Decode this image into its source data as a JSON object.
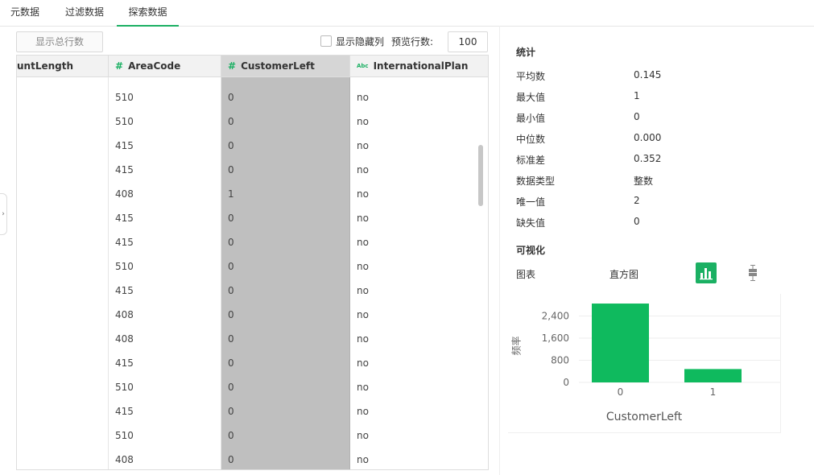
{
  "tabs": [
    {
      "label": "元数据",
      "active": false
    },
    {
      "label": "过滤数据",
      "active": false
    },
    {
      "label": "探索数据",
      "active": true
    }
  ],
  "toolbar": {
    "show_total_rows": "显示总行数",
    "show_hidden_cols": "显示隐藏列",
    "preview_rows_label": "预览行数:",
    "preview_rows_value": "100"
  },
  "grid": {
    "columns": [
      {
        "label": "untLength",
        "type": "none",
        "selected": false
      },
      {
        "label": "AreaCode",
        "type": "#",
        "selected": false
      },
      {
        "label": "CustomerLeft",
        "type": "#",
        "selected": true
      },
      {
        "label": "InternationalPlan",
        "type": "Abc",
        "selected": false
      }
    ],
    "rows": [
      [
        "",
        "510",
        "0",
        "no"
      ],
      [
        "",
        "510",
        "0",
        "no"
      ],
      [
        "",
        "415",
        "0",
        "no"
      ],
      [
        "",
        "415",
        "0",
        "no"
      ],
      [
        "",
        "408",
        "1",
        "no"
      ],
      [
        "",
        "415",
        "0",
        "no"
      ],
      [
        "",
        "415",
        "0",
        "no"
      ],
      [
        "",
        "510",
        "0",
        "no"
      ],
      [
        "",
        "415",
        "0",
        "no"
      ],
      [
        "",
        "408",
        "0",
        "no"
      ],
      [
        "",
        "408",
        "0",
        "no"
      ],
      [
        "",
        "415",
        "0",
        "no"
      ],
      [
        "",
        "510",
        "0",
        "no"
      ],
      [
        "",
        "415",
        "0",
        "no"
      ],
      [
        "",
        "510",
        "0",
        "no"
      ],
      [
        "",
        "408",
        "0",
        "no"
      ]
    ]
  },
  "stats": {
    "title": "统计",
    "items": [
      {
        "label": "平均数",
        "value": "0.145"
      },
      {
        "label": "最大值",
        "value": "1"
      },
      {
        "label": "最小值",
        "value": "0"
      },
      {
        "label": "中位数",
        "value": "0.000"
      },
      {
        "label": "标准差",
        "value": "0.352"
      },
      {
        "label": "数据类型",
        "value": "整数"
      },
      {
        "label": "唯一值",
        "value": "2"
      },
      {
        "label": "缺失值",
        "value": "0"
      }
    ]
  },
  "viz": {
    "title": "可视化",
    "chart_label": "图表",
    "chart_type": "直方图",
    "icons": {
      "histogram": "bar-chart-icon",
      "boxplot": "boxplot-icon"
    }
  },
  "colors": {
    "accent": "#1bb063",
    "bar": "#0fba5e",
    "selected_col": "#bfbfbf"
  },
  "chart_data": {
    "type": "bar",
    "categories": [
      "0",
      "1"
    ],
    "values": [
      2850,
      483
    ],
    "xlabel": "CustomerLeft",
    "ylabel": "频率",
    "yticks": [
      0,
      800,
      1600,
      2400
    ],
    "ylim": [
      0,
      3200
    ],
    "grid": true
  }
}
